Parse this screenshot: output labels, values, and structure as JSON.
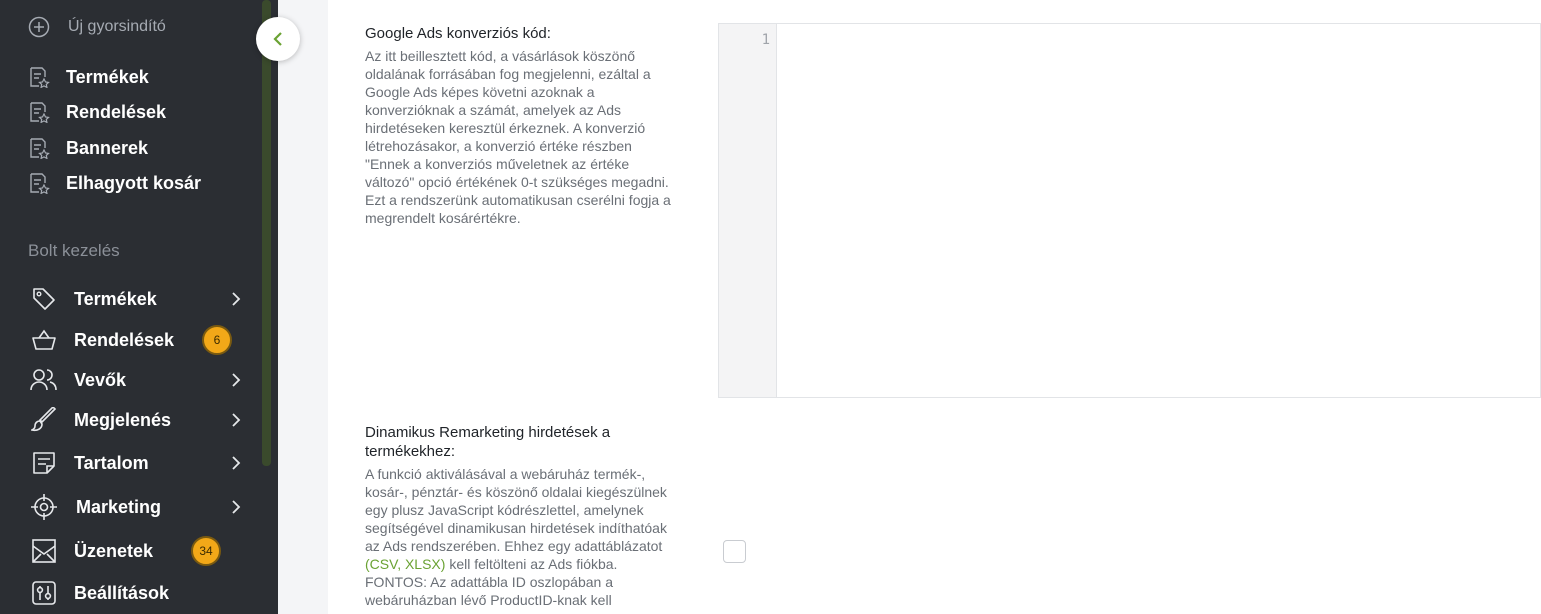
{
  "sidebar": {
    "quick_add": "Új gyorsindító",
    "shortcuts": [
      {
        "label": "Termékek"
      },
      {
        "label": "Rendelések"
      },
      {
        "label": "Bannerek"
      },
      {
        "label": "Elhagyott kosár"
      }
    ],
    "section_label": "Bolt kezelés",
    "nav": [
      {
        "label": "Termékek",
        "icon": "tag-icon"
      },
      {
        "label": "Rendelések",
        "icon": "basket-icon",
        "badge": "6"
      },
      {
        "label": "Vevők",
        "icon": "users-icon"
      },
      {
        "label": "Megjelenés",
        "icon": "brush-icon"
      },
      {
        "label": "Tartalom",
        "icon": "document-icon"
      },
      {
        "label": "Marketing",
        "icon": "target-icon"
      },
      {
        "label": "Üzenetek",
        "icon": "message-icon",
        "badge": "34"
      },
      {
        "label": "Beállítások",
        "icon": "settings-icon"
      }
    ],
    "accent_color": "#f2a818"
  },
  "main": {
    "ads_field": {
      "title": "Google Ads konverziós kód:",
      "description": [
        "Az itt beillesztett kód, a vásárlások köszönő",
        "oldalának forrásában fog megjelenni, ezáltal a",
        "Google Ads képes követni azoknak a",
        "konverzióknak a számát, amelyek az Ads",
        "hirdetéseken keresztül érkeznek. A konverzió",
        "létrehozásakor, a konverzió értéke részben",
        "\"Ennek a konverziós műveletnek az értéke",
        "változó\" opció értékének 0-t szükséges megadni.",
        "Ezt a rendszerünk automatikusan cserélni fogja a",
        "megrendelt kosárértékre."
      ],
      "line_number": "1"
    },
    "remarketing_field": {
      "title_lines": [
        "Dinamikus Remarketing hirdetések a",
        "termékekhez:"
      ],
      "description": [
        "A funkció aktiválásával a webáruház termék-,",
        "kosár-, pénztár- és köszönő oldalai kiegészülnek",
        "egy plusz JavaScript kódrészlettel, amelynek",
        "segítségével dinamikusan hirdetések indíthatóak",
        "az Ads rendszerében. Ehhez egy adattáblázatot"
      ],
      "link_open": "(",
      "link_csv": "CSV",
      "link_sep": ", ",
      "link_xlsx": "XLSX",
      "link_close": ")",
      "after_links": " kell feltölteni az Ads fiókba.",
      "description_tail": [
        "FONTOS: Az adattábla ID oszlopában a",
        "webáruházban lévő ProductID-knak kell"
      ],
      "link_color": "#6aa233"
    }
  }
}
